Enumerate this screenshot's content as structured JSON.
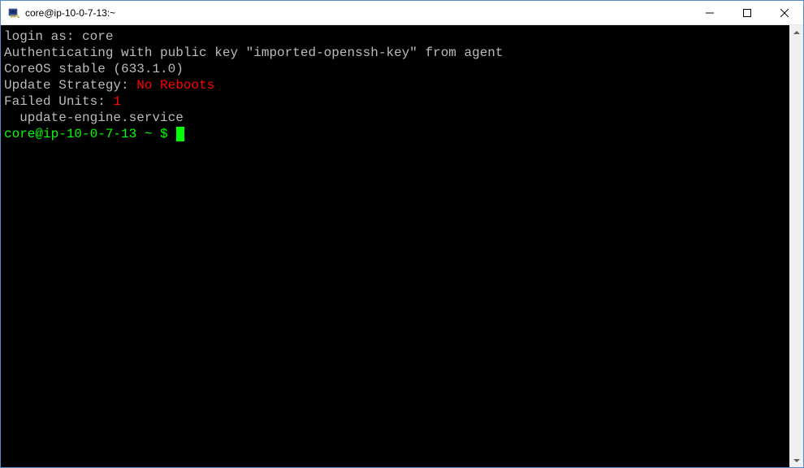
{
  "window": {
    "title": "core@ip-10-0-7-13:~"
  },
  "terminal": {
    "login_label": "login as: ",
    "login_user": "core",
    "auth_line": "Authenticating with public key \"imported-openssh-key\" from agent",
    "os_line": "CoreOS stable (633.1.0)",
    "update_label": "Update Strategy: ",
    "update_value": "No Reboots",
    "failed_label": "Failed Units: ",
    "failed_count": "1",
    "failed_unit": "  update-engine.service",
    "prompt": "core@ip-10-0-7-13 ~ $ "
  }
}
